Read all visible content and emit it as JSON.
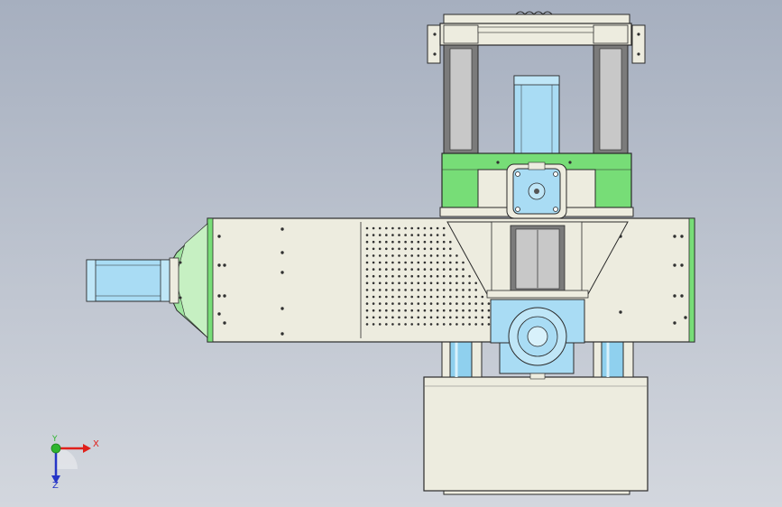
{
  "window": {
    "background_top": "#a6afbf",
    "background_bottom": "#d3d7de"
  },
  "model": {
    "part_color": "#edecdf",
    "edge_color": "#2a2a2a",
    "highlight_green": "#77dd77",
    "motor_blue": "#a9dcf4",
    "rod_blue": "#8fd0ee",
    "hole_color": "#303030"
  },
  "triad": {
    "x_label": "X",
    "y_label": "Y",
    "z_label": "Z",
    "x_color": "#e0201b",
    "y_color": "#2fb52f",
    "z_color": "#2535c7",
    "icon": "coordinate-triad-icon"
  }
}
